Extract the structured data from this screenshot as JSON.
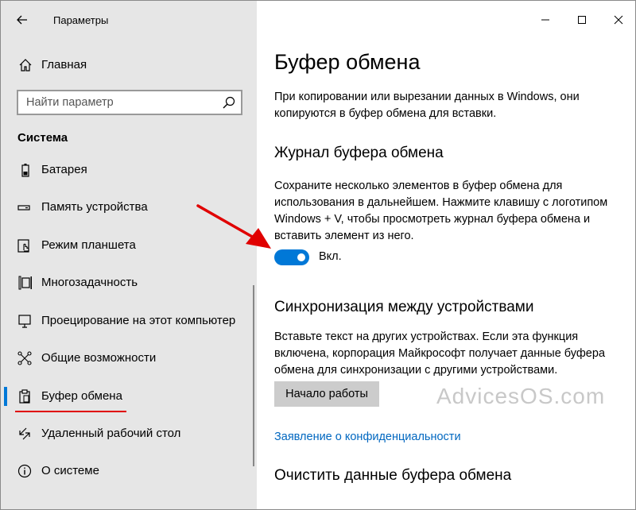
{
  "window": {
    "title": "Параметры",
    "controls": [
      "minimize-icon",
      "maximize-icon",
      "close-icon"
    ]
  },
  "sidebar": {
    "home_label": "Главная",
    "search_placeholder": "Найти параметр",
    "section_title": "Система",
    "items": [
      {
        "label": "Батарея",
        "icon": "battery-icon"
      },
      {
        "label": "Память устройства",
        "icon": "storage-icon"
      },
      {
        "label": "Режим планшета",
        "icon": "tablet-mode-icon"
      },
      {
        "label": "Многозадачность",
        "icon": "multitasking-icon"
      },
      {
        "label": "Проецирование на этот компьютер",
        "icon": "projecting-icon"
      },
      {
        "label": "Общие возможности",
        "icon": "shared-experiences-icon"
      },
      {
        "label": "Буфер обмена",
        "icon": "clipboard-icon",
        "active": true
      },
      {
        "label": "Удаленный рабочий стол",
        "icon": "remote-desktop-icon"
      },
      {
        "label": "О системе",
        "icon": "info-icon"
      }
    ]
  },
  "content": {
    "title": "Буфер обмена",
    "intro": "При копировании или вырезании данных в Windows, они копируются в буфер обмена для вставки.",
    "history": {
      "heading": "Журнал буфера обмена",
      "description": "Сохраните несколько элементов в буфер обмена для использования в дальнейшем. Нажмите клавишу с логотипом Windows + V, чтобы просмотреть журнал буфера обмена и вставить элемент из него.",
      "toggle_state": "Вкл."
    },
    "sync": {
      "heading": "Синхронизация между устройствами",
      "description": "Вставьте текст на других устройствах. Если эта функция включена, корпорация Майкрософт получает данные буфера обмена для синхронизации с другими устройствами.",
      "button_label": "Начало работы"
    },
    "privacy_link": "Заявление о конфиденциальности",
    "clear": {
      "heading": "Очистить данные буфера обмена"
    }
  },
  "watermark": "AdvicesOS.com",
  "colors": {
    "accent": "#0078d7",
    "link": "#0067c0",
    "annotation": "#e00000",
    "sidebar_bg": "#e6e6e6"
  }
}
